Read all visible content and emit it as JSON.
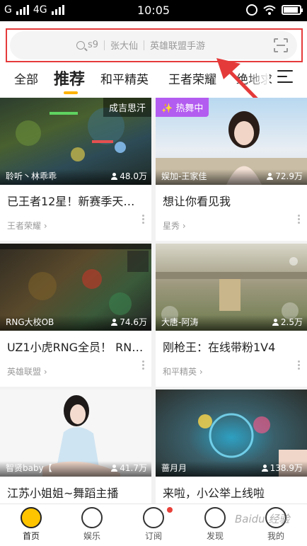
{
  "status_bar": {
    "carrier_left": "G",
    "network": "4G",
    "time": "10:05",
    "battery_level": 0.9
  },
  "search": {
    "hints": [
      "s9",
      "张大仙",
      "英雄联盟手游"
    ]
  },
  "tabs": [
    {
      "label": "全部",
      "active": false
    },
    {
      "label": "推荐",
      "active": true
    },
    {
      "label": "和平精英",
      "active": false
    },
    {
      "label": "王者荣耀",
      "active": false
    },
    {
      "label": "绝地求",
      "active": false
    }
  ],
  "cards": [
    {
      "badge": "成吉思汗",
      "anchor": "聆听丶林乖乖",
      "viewers": "48.0万",
      "title": "已王者12星！新赛季天…",
      "category": "王者荣耀"
    },
    {
      "badge": "✨ 热舞中",
      "anchor": "娱加-王家佳",
      "viewers": "72.9万",
      "title": "想让你看见我",
      "category": "星秀"
    },
    {
      "badge": "",
      "anchor": "RNG大校OB",
      "viewers": "74.6万",
      "title": "UZ1小虎RNG全员！ RN…",
      "category": "英雄联盟"
    },
    {
      "badge": "",
      "anchor": "大唐-阿涛",
      "viewers": "2.5万",
      "title": "刚枪王：在线带粉1V4",
      "category": "和平精英"
    },
    {
      "badge": "",
      "anchor": "智贤baby【",
      "viewers": "41.7万",
      "title": "江苏小姐姐~舞蹈主播",
      "category": ""
    },
    {
      "badge": "",
      "anchor": "蔷月月",
      "viewers": "138.9万",
      "title": "来啦，小公举上线啦",
      "category": ""
    }
  ],
  "bottom_nav": [
    {
      "label": "首页",
      "icon": "home-icon",
      "active": true
    },
    {
      "label": "娱乐",
      "icon": "entertainment-icon",
      "active": false
    },
    {
      "label": "订阅",
      "icon": "subscribe-icon",
      "active": false
    },
    {
      "label": "发现",
      "icon": "discover-icon",
      "active": false
    },
    {
      "label": "我的",
      "icon": "profile-icon",
      "active": false
    }
  ],
  "watermark": "Baidu 经验",
  "colors": {
    "accent": "#ffb300",
    "highlight": "#e53a3a",
    "dance_badge": "#b35cf0"
  }
}
